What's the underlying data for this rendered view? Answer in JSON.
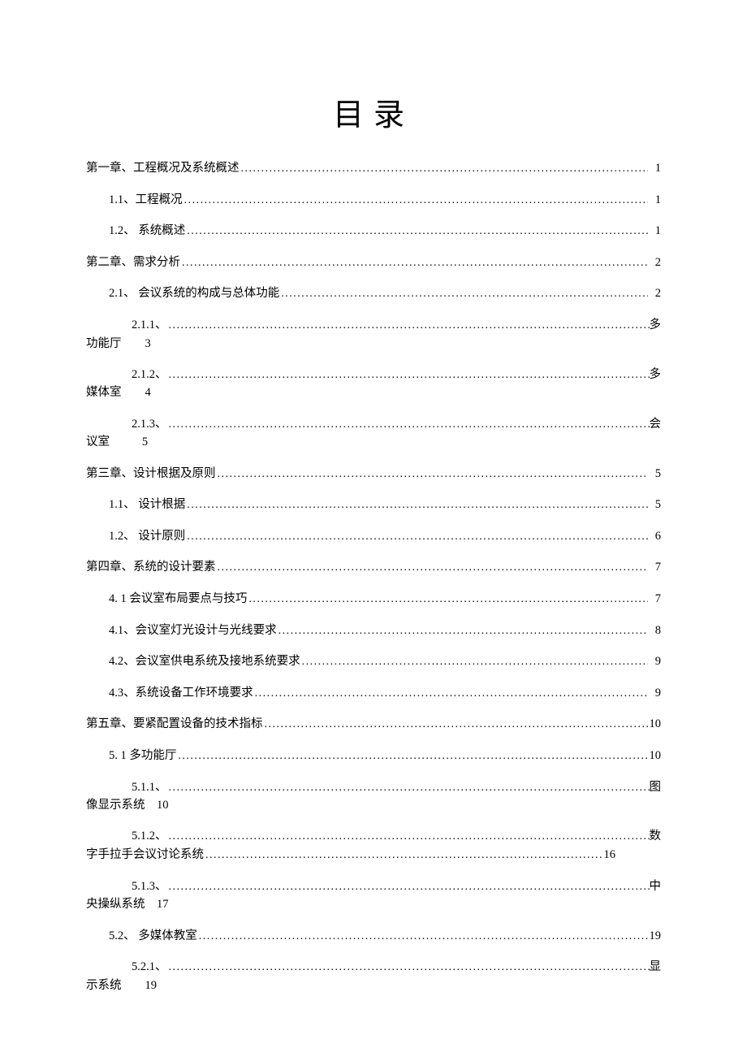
{
  "title": "目录",
  "toc": {
    "e1": {
      "label": "第一章、工程概况及系统概述",
      "page": "1"
    },
    "e2": {
      "label": "1.1、工程概况",
      "page": "1"
    },
    "e3": {
      "label": "1.2、 系统概述",
      "page": "1"
    },
    "e4": {
      "label": "第二章、需求分析",
      "page": "2"
    },
    "e5": {
      "label": "2.1、 会议系统的构成与总体功能",
      "page": "2"
    },
    "e6": {
      "label": "2.1.1、",
      "tail": "多",
      "wrap_left": "功能厅",
      "wrap_page": "3"
    },
    "e7": {
      "label": "2.1.2、",
      "tail": "多",
      "wrap_left": "媒体室",
      "wrap_page": "4"
    },
    "e8": {
      "label": "2.1.3、",
      "tail": "会",
      "wrap_left": "议室",
      "wrap_page": "5"
    },
    "e9": {
      "label": "第三章、设计根据及原则",
      "page": "5"
    },
    "e10": {
      "label": "1.1、 设计根据",
      "page": "5"
    },
    "e11": {
      "label": "1.2、 设计原则",
      "page": "6"
    },
    "e12": {
      "label": "第四章、系统的设计要素",
      "page": "7"
    },
    "e13": {
      "label": "4.  1 会议室布局要点与技巧",
      "page": "7"
    },
    "e14": {
      "label": "4.1、会议室灯光设计与光线要求",
      "page": "8"
    },
    "e15": {
      "label": "4.2、会议室供电系统及接地系统要求",
      "page": "9"
    },
    "e16": {
      "label": "4.3、系统设备工作环境要求",
      "page": "9"
    },
    "e17": {
      "label": "第五章、要紧配置设备的技术指标",
      "page": "10"
    },
    "e18": {
      "label": "5.  1 多功能厅",
      "page": "10"
    },
    "e19": {
      "label": "5.1.1、",
      "tail": "图",
      "wrap_left": "像显示系统",
      "wrap_page": "10"
    },
    "e20": {
      "label": "5.1.2、",
      "tail": "数",
      "wrap_left": "字手拉手会议讨论系统",
      "wrap_page": "16",
      "wrap_uses_dots": true
    },
    "e21": {
      "label": "5.1.3、",
      "tail": "中",
      "wrap_left": "央操纵系统",
      "wrap_page": "17"
    },
    "e22": {
      "label": "5.2、 多媒体教室",
      "page": "19"
    },
    "e23": {
      "label": "5.2.1、",
      "tail": "显",
      "wrap_left": "示系统",
      "wrap_page": "19"
    }
  }
}
